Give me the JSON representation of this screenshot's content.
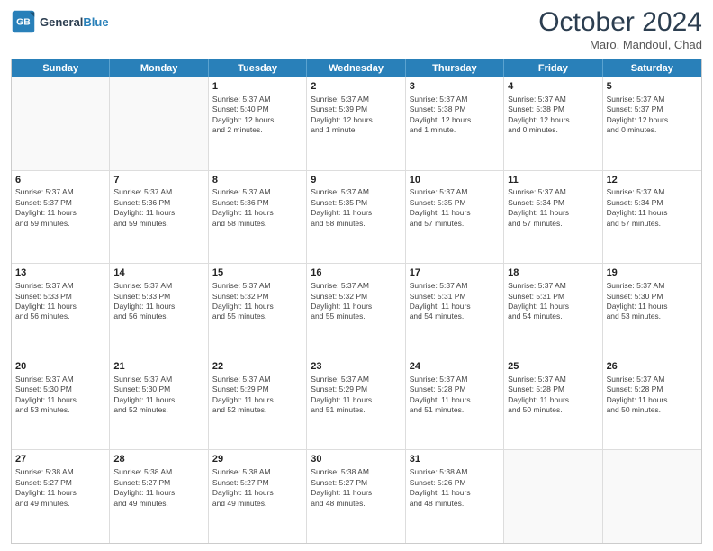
{
  "logo": {
    "line1": "General",
    "line2": "Blue"
  },
  "title": "October 2024",
  "location": "Maro, Mandoul, Chad",
  "days": [
    "Sunday",
    "Monday",
    "Tuesday",
    "Wednesday",
    "Thursday",
    "Friday",
    "Saturday"
  ],
  "weeks": [
    [
      {
        "day": "",
        "info": ""
      },
      {
        "day": "",
        "info": ""
      },
      {
        "day": "1",
        "info": "Sunrise: 5:37 AM\nSunset: 5:40 PM\nDaylight: 12 hours\nand 2 minutes."
      },
      {
        "day": "2",
        "info": "Sunrise: 5:37 AM\nSunset: 5:39 PM\nDaylight: 12 hours\nand 1 minute."
      },
      {
        "day": "3",
        "info": "Sunrise: 5:37 AM\nSunset: 5:38 PM\nDaylight: 12 hours\nand 1 minute."
      },
      {
        "day": "4",
        "info": "Sunrise: 5:37 AM\nSunset: 5:38 PM\nDaylight: 12 hours\nand 0 minutes."
      },
      {
        "day": "5",
        "info": "Sunrise: 5:37 AM\nSunset: 5:37 PM\nDaylight: 12 hours\nand 0 minutes."
      }
    ],
    [
      {
        "day": "6",
        "info": "Sunrise: 5:37 AM\nSunset: 5:37 PM\nDaylight: 11 hours\nand 59 minutes."
      },
      {
        "day": "7",
        "info": "Sunrise: 5:37 AM\nSunset: 5:36 PM\nDaylight: 11 hours\nand 59 minutes."
      },
      {
        "day": "8",
        "info": "Sunrise: 5:37 AM\nSunset: 5:36 PM\nDaylight: 11 hours\nand 58 minutes."
      },
      {
        "day": "9",
        "info": "Sunrise: 5:37 AM\nSunset: 5:35 PM\nDaylight: 11 hours\nand 58 minutes."
      },
      {
        "day": "10",
        "info": "Sunrise: 5:37 AM\nSunset: 5:35 PM\nDaylight: 11 hours\nand 57 minutes."
      },
      {
        "day": "11",
        "info": "Sunrise: 5:37 AM\nSunset: 5:34 PM\nDaylight: 11 hours\nand 57 minutes."
      },
      {
        "day": "12",
        "info": "Sunrise: 5:37 AM\nSunset: 5:34 PM\nDaylight: 11 hours\nand 57 minutes."
      }
    ],
    [
      {
        "day": "13",
        "info": "Sunrise: 5:37 AM\nSunset: 5:33 PM\nDaylight: 11 hours\nand 56 minutes."
      },
      {
        "day": "14",
        "info": "Sunrise: 5:37 AM\nSunset: 5:33 PM\nDaylight: 11 hours\nand 56 minutes."
      },
      {
        "day": "15",
        "info": "Sunrise: 5:37 AM\nSunset: 5:32 PM\nDaylight: 11 hours\nand 55 minutes."
      },
      {
        "day": "16",
        "info": "Sunrise: 5:37 AM\nSunset: 5:32 PM\nDaylight: 11 hours\nand 55 minutes."
      },
      {
        "day": "17",
        "info": "Sunrise: 5:37 AM\nSunset: 5:31 PM\nDaylight: 11 hours\nand 54 minutes."
      },
      {
        "day": "18",
        "info": "Sunrise: 5:37 AM\nSunset: 5:31 PM\nDaylight: 11 hours\nand 54 minutes."
      },
      {
        "day": "19",
        "info": "Sunrise: 5:37 AM\nSunset: 5:30 PM\nDaylight: 11 hours\nand 53 minutes."
      }
    ],
    [
      {
        "day": "20",
        "info": "Sunrise: 5:37 AM\nSunset: 5:30 PM\nDaylight: 11 hours\nand 53 minutes."
      },
      {
        "day": "21",
        "info": "Sunrise: 5:37 AM\nSunset: 5:30 PM\nDaylight: 11 hours\nand 52 minutes."
      },
      {
        "day": "22",
        "info": "Sunrise: 5:37 AM\nSunset: 5:29 PM\nDaylight: 11 hours\nand 52 minutes."
      },
      {
        "day": "23",
        "info": "Sunrise: 5:37 AM\nSunset: 5:29 PM\nDaylight: 11 hours\nand 51 minutes."
      },
      {
        "day": "24",
        "info": "Sunrise: 5:37 AM\nSunset: 5:28 PM\nDaylight: 11 hours\nand 51 minutes."
      },
      {
        "day": "25",
        "info": "Sunrise: 5:37 AM\nSunset: 5:28 PM\nDaylight: 11 hours\nand 50 minutes."
      },
      {
        "day": "26",
        "info": "Sunrise: 5:37 AM\nSunset: 5:28 PM\nDaylight: 11 hours\nand 50 minutes."
      }
    ],
    [
      {
        "day": "27",
        "info": "Sunrise: 5:38 AM\nSunset: 5:27 PM\nDaylight: 11 hours\nand 49 minutes."
      },
      {
        "day": "28",
        "info": "Sunrise: 5:38 AM\nSunset: 5:27 PM\nDaylight: 11 hours\nand 49 minutes."
      },
      {
        "day": "29",
        "info": "Sunrise: 5:38 AM\nSunset: 5:27 PM\nDaylight: 11 hours\nand 49 minutes."
      },
      {
        "day": "30",
        "info": "Sunrise: 5:38 AM\nSunset: 5:27 PM\nDaylight: 11 hours\nand 48 minutes."
      },
      {
        "day": "31",
        "info": "Sunrise: 5:38 AM\nSunset: 5:26 PM\nDaylight: 11 hours\nand 48 minutes."
      },
      {
        "day": "",
        "info": ""
      },
      {
        "day": "",
        "info": ""
      }
    ]
  ]
}
